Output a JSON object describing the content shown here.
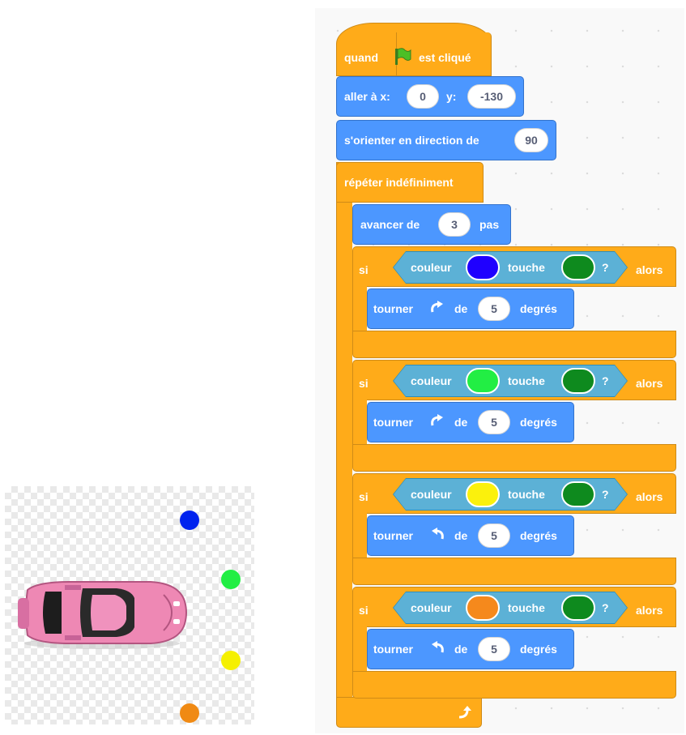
{
  "sprite_panel": {
    "sprite": "pink-car",
    "dots": [
      {
        "name": "blue-dot",
        "color": "#0022ee"
      },
      {
        "name": "green-dot",
        "color": "#22ee44"
      },
      {
        "name": "yellow-dot",
        "color": "#f5f000"
      },
      {
        "name": "orange-dot",
        "color": "#f08a14"
      }
    ]
  },
  "script": {
    "hat": {
      "label_before": "quand",
      "icon": "green-flag-icon",
      "label_after": "est cliqué"
    },
    "goto": {
      "label": "aller à x:",
      "x_value": "0",
      "y_label": "y:",
      "y_value": "-130"
    },
    "point": {
      "label": "s'orienter en direction de",
      "value": "90"
    },
    "forever": {
      "label": "répéter indéfiniment",
      "icon": "loop-arrow-icon"
    },
    "move": {
      "label": "avancer de",
      "value": "3",
      "unit": "pas"
    },
    "if_blocks": [
      {
        "si": "si",
        "couleur": "couleur",
        "color": "#1f00ff",
        "touche": "touche",
        "target_color": "#0e8a1e",
        "question": "?",
        "alors": "alors",
        "turn": {
          "label": "tourner",
          "direction": "clockwise",
          "de": "de",
          "value": "5",
          "unit": "degrés"
        }
      },
      {
        "si": "si",
        "couleur": "couleur",
        "color": "#22ee44",
        "touche": "touche",
        "target_color": "#0e8a1e",
        "question": "?",
        "alors": "alors",
        "turn": {
          "label": "tourner",
          "direction": "clockwise",
          "de": "de",
          "value": "5",
          "unit": "degrés"
        }
      },
      {
        "si": "si",
        "couleur": "couleur",
        "color": "#fbf10c",
        "touche": "touche",
        "target_color": "#0e8a1e",
        "question": "?",
        "alors": "alors",
        "turn": {
          "label": "tourner",
          "direction": "counterclockwise",
          "de": "de",
          "value": "5",
          "unit": "degrés"
        }
      },
      {
        "si": "si",
        "couleur": "couleur",
        "color": "#f5891c",
        "touche": "touche",
        "target_color": "#0e8a1e",
        "question": "?",
        "alors": "alors",
        "turn": {
          "label": "tourner",
          "direction": "counterclockwise",
          "de": "de",
          "value": "5",
          "unit": "degrés"
        }
      }
    ]
  }
}
